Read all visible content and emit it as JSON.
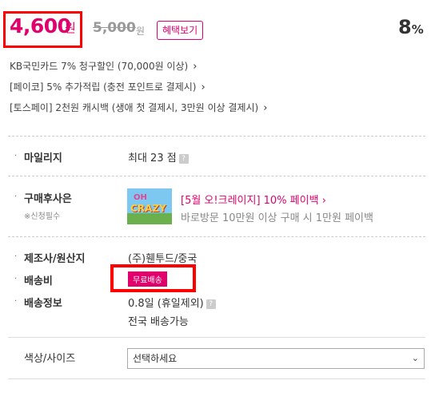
{
  "price": {
    "current": "4,600",
    "current_unit": "원",
    "original": "5,000",
    "original_unit": "원",
    "benefit_button": "혜택보기",
    "discount": "8",
    "discount_unit": "%"
  },
  "promos": [
    {
      "text": "KB국민카드 7% 청구할인 (70,000원 이상)",
      "chevron": "›"
    },
    {
      "text": "[페이코] 5% 추가적립 (충전 포인트로 결제시)",
      "chevron": "›"
    },
    {
      "text": "[토스페이] 2천원 캐시백 (생애 첫 결제시, 3만원 이상 결제시)",
      "chevron": "›"
    }
  ],
  "mileage": {
    "label": "마일리지",
    "value": "최대 23 점",
    "help": "?"
  },
  "gift": {
    "label": "구매후사은",
    "sublabel": "※신청필수",
    "thumb_top": "OH",
    "thumb_bottom": "CRAZY",
    "title": "[5월 오!크레이지] 10% 페이백",
    "chevron": "›",
    "desc": "바로방문 10만원 이상 구매 시 1만원 페이백"
  },
  "maker": {
    "label": "제조사/원산지",
    "value": "(주)휀투드/중국"
  },
  "shipping_fee": {
    "label": "배송비",
    "badge": "무료배송"
  },
  "shipping_info": {
    "label": "배송정보",
    "value": "0.8일 (휴일제외)",
    "help": "?",
    "value2": "전국 배송가능"
  },
  "option": {
    "label": "색상/사이즈",
    "select_value": "선택하세요",
    "arrow": "⌄"
  },
  "bullet": "·",
  "colors": {
    "accent": "#e1006b",
    "highlight_box": "#ff0000"
  }
}
